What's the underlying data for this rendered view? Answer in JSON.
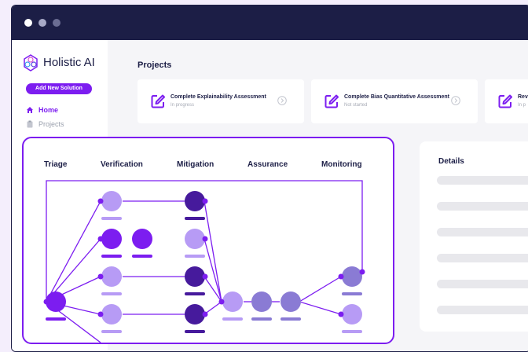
{
  "app": {
    "name": "Holistic AI",
    "add_button_label": "Add New Solution"
  },
  "sidebar": {
    "items": [
      {
        "label": "Home",
        "icon": "home-icon",
        "active": true
      },
      {
        "label": "Projects",
        "icon": "clipboard-icon",
        "active": false
      }
    ]
  },
  "projects": {
    "title": "Projects",
    "cards": [
      {
        "title": "Complete Explainability Assessment",
        "status": "In progress"
      },
      {
        "title": "Complete Bias Quantitative Assessment",
        "status": "Not started"
      },
      {
        "title": "Rev",
        "status": "In p"
      }
    ]
  },
  "pipeline": {
    "stages": [
      "Triage",
      "Verification",
      "Mitigation",
      "Assurance",
      "Monitoring"
    ]
  },
  "details": {
    "title": "Details"
  },
  "colors": {
    "accent": "#7c1df0",
    "navy": "#1c1e46",
    "light_purple": "#b79bf5",
    "dark_purple": "#461a9c",
    "mid_purple": "#8a7bd4"
  }
}
